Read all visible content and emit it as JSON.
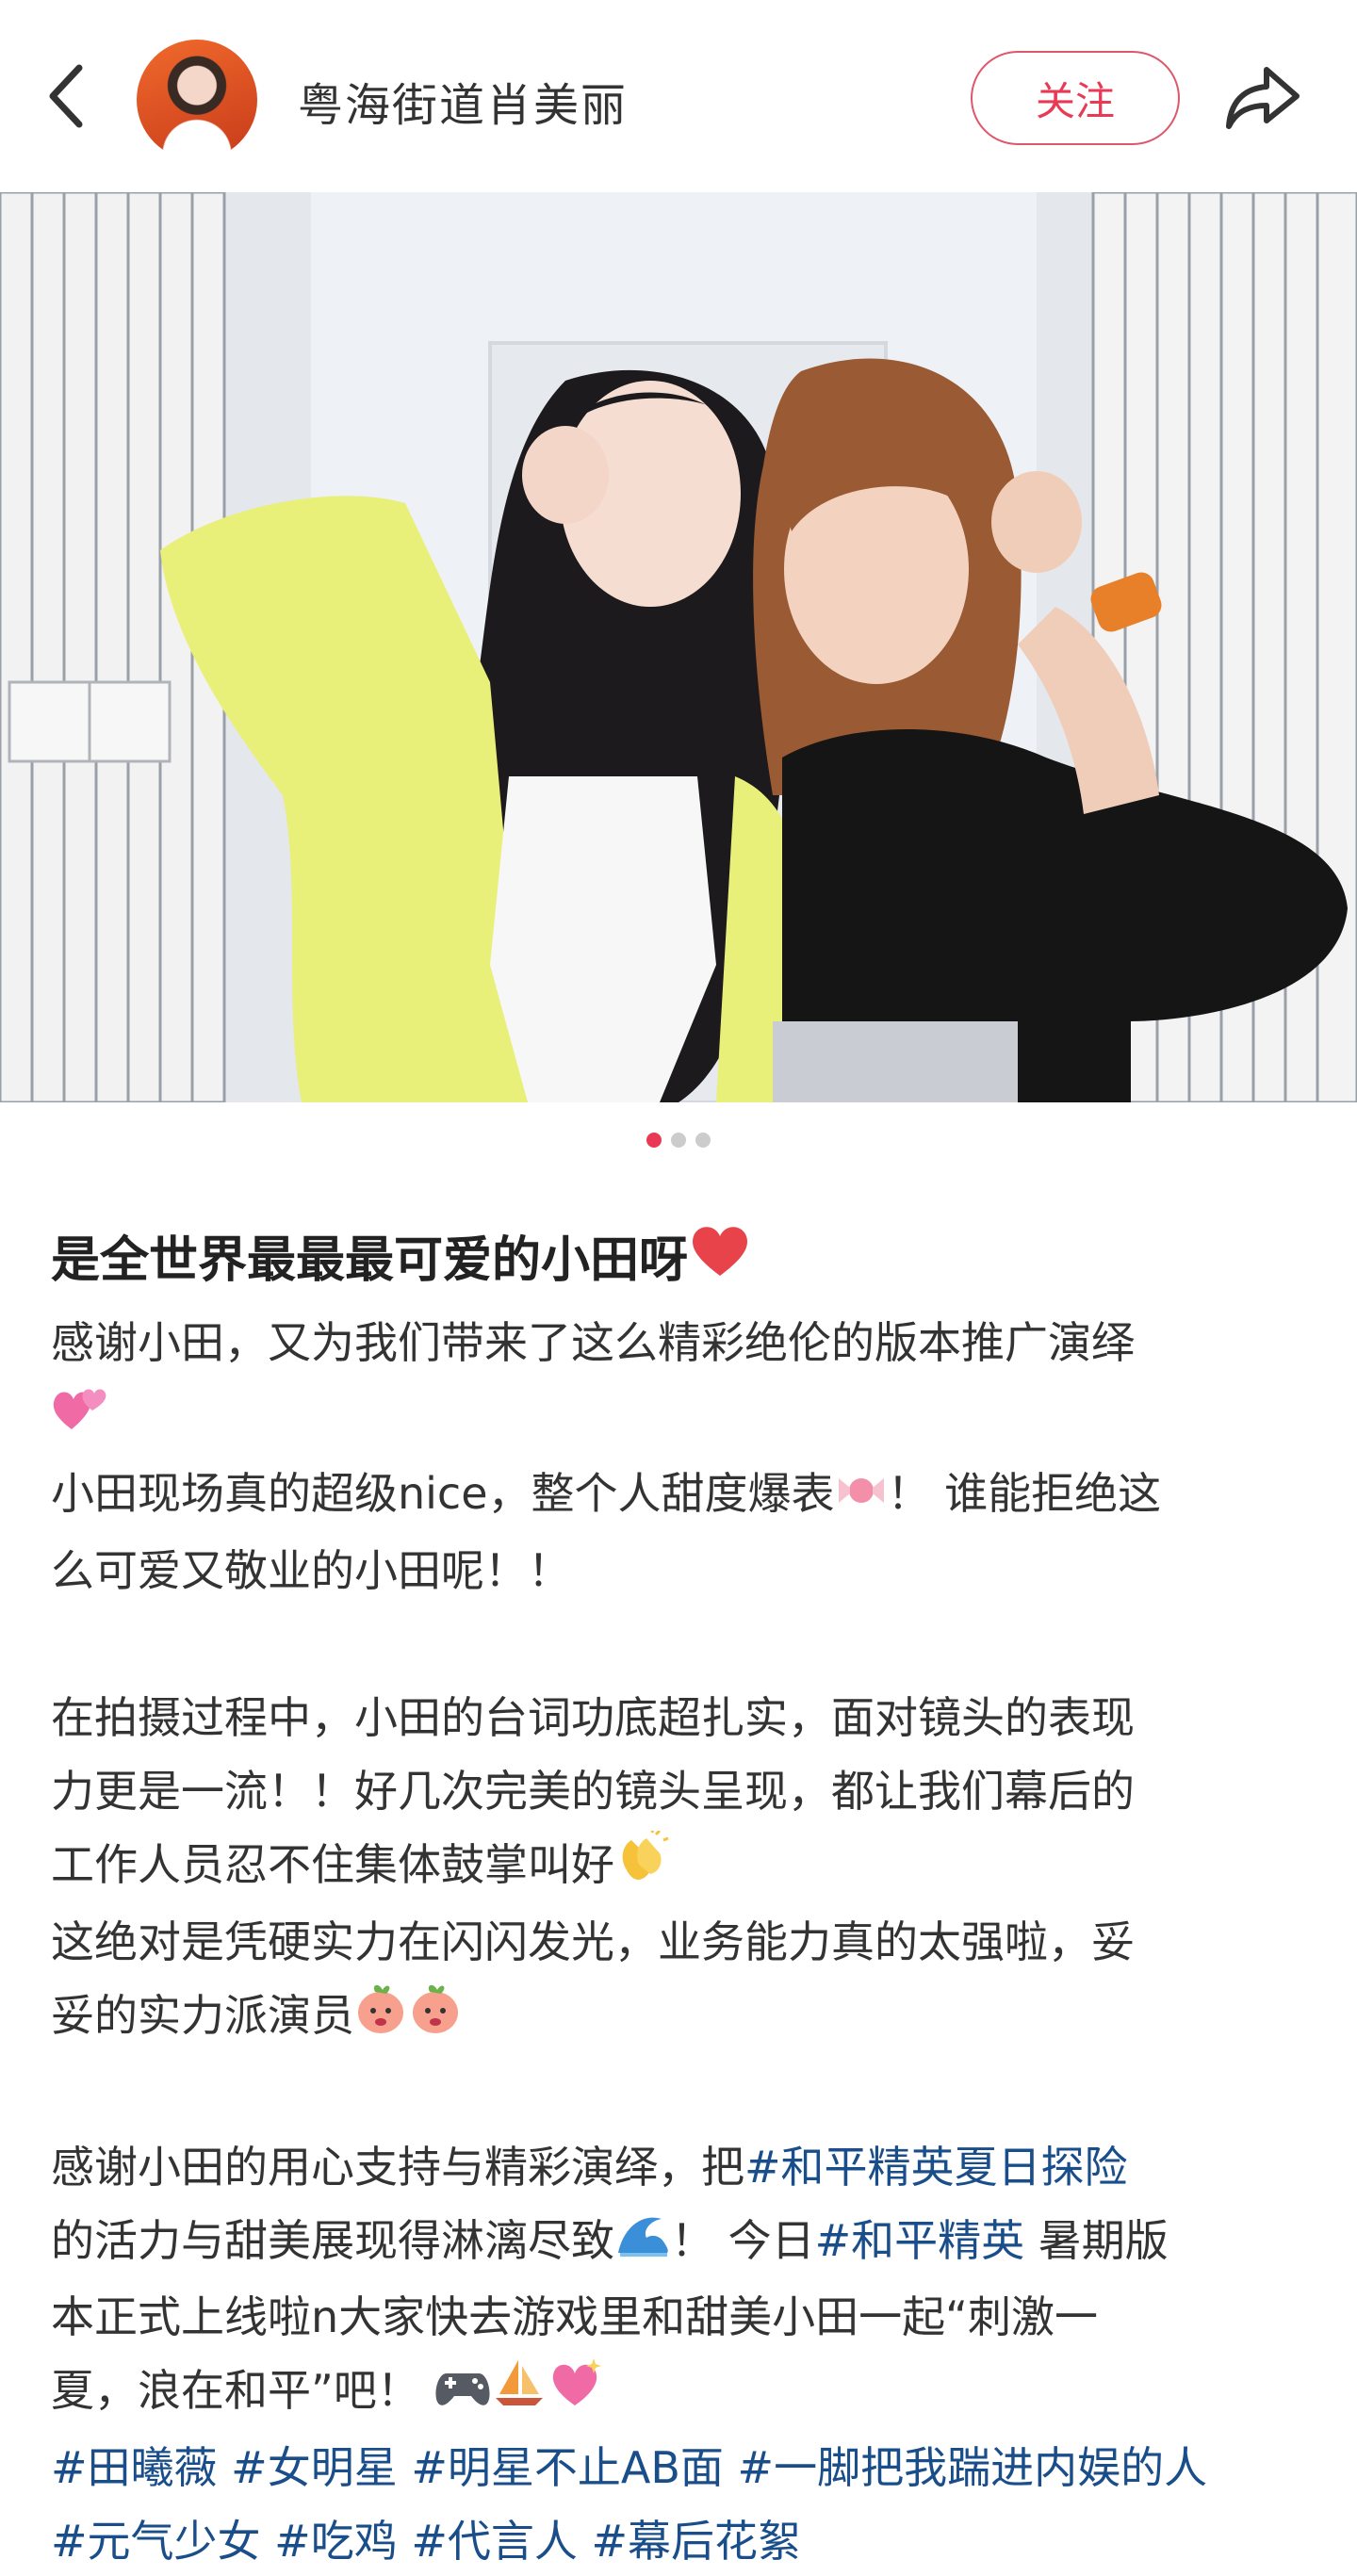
{
  "header": {
    "username": "粤海街道肖美丽",
    "follow_label": "关注"
  },
  "carousel": {
    "total": 3,
    "active": 1
  },
  "post": {
    "title": "是全世界最最最可爱的小田呀",
    "p1_l1": "感谢小田，又为我们带来了这么精彩绝伦的版本推广演绎",
    "p1_l3a": "小田现场真的超级nice，整个人甜度爆表",
    "p1_l3b": "！ 谁能拒绝这",
    "p1_l4": "么可爱又敬业的小田呢！！",
    "p2_l1": "在拍摄过程中，小田的台词功底超扎实，面对镜头的表现",
    "p2_l2": "力更是一流！！好几次完美的镜头呈现，都让我们幕后的",
    "p2_l3": "工作人员忍不住集体鼓掌叫好",
    "p2_l4": "这绝对是凭硬实力在闪闪发光，业务能力真的太强啦，妥",
    "p2_l5": "妥的实力派演员",
    "p3_l1a": "感谢小田的用心支持与精彩演绎，把",
    "p3_tag1": "#和平精英夏日探险",
    "p3_l2a": "的活力与甜美展现得淋漓尽致",
    "p3_l2b": "！ 今日",
    "p3_tag2": "#和平精英",
    "p3_l2c": " 暑期版",
    "p3_l3": "本正式上线啦n大家快去游戏里和甜美小田一起“刺激一",
    "p3_l4": "夏，浪在和平”吧！",
    "tags_line1": [
      "#田曦薇",
      "#女明星",
      "#明星不止AB面",
      "#一脚把我踹进内娱的人"
    ],
    "tags_line2": [
      "#元气少女",
      "#吃鸡",
      "#代言人",
      "#幕后花絮"
    ]
  },
  "colors": {
    "accent": "#e83a55",
    "tag": "#1a4e8a"
  }
}
